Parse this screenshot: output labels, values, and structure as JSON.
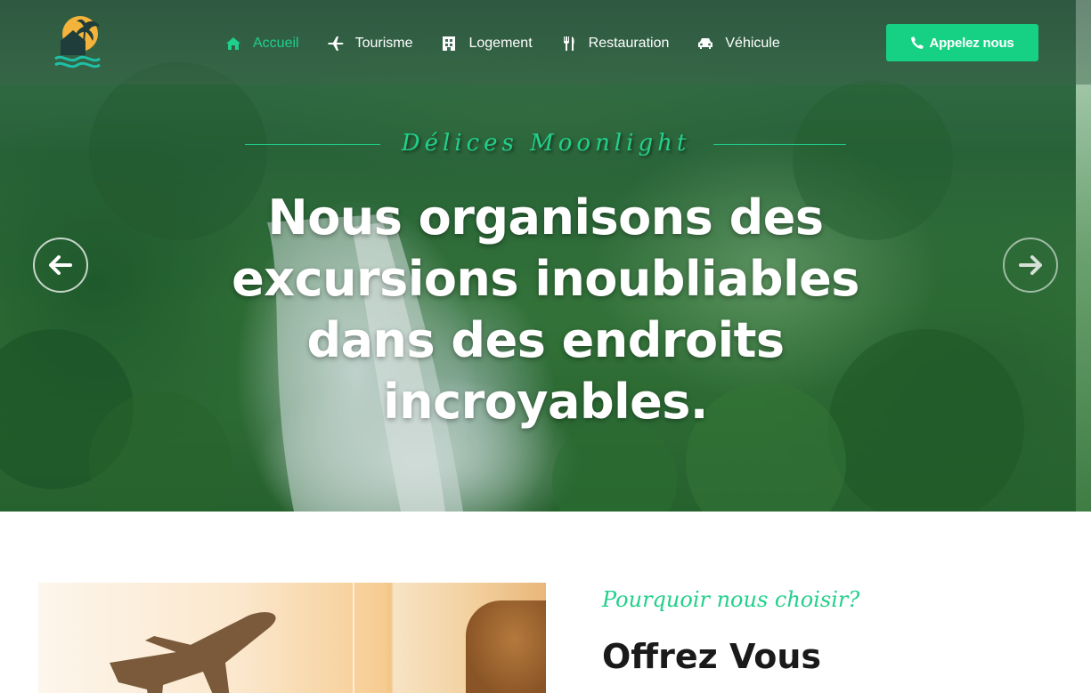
{
  "nav": {
    "items": [
      {
        "label": "Accueil",
        "icon": "home-icon",
        "active": true
      },
      {
        "label": "Tourisme",
        "icon": "plane-icon",
        "active": false
      },
      {
        "label": "Logement",
        "icon": "building-icon",
        "active": false
      },
      {
        "label": "Restauration",
        "icon": "utensils-icon",
        "active": false
      },
      {
        "label": "Véhicule",
        "icon": "car-icon",
        "active": false
      }
    ],
    "call_button": "Appelez nous"
  },
  "hero": {
    "kicker": "Délices Moonlight",
    "headline": "Nous organisons des excursions inoubliables dans des endroits incroyables."
  },
  "about": {
    "kicker": "Pourquoir nous choisir?",
    "title": "Offrez Vous"
  },
  "colors": {
    "accent": "#16d184",
    "accent_text": "#1fcf8c",
    "heading": "#1a1a1a"
  }
}
